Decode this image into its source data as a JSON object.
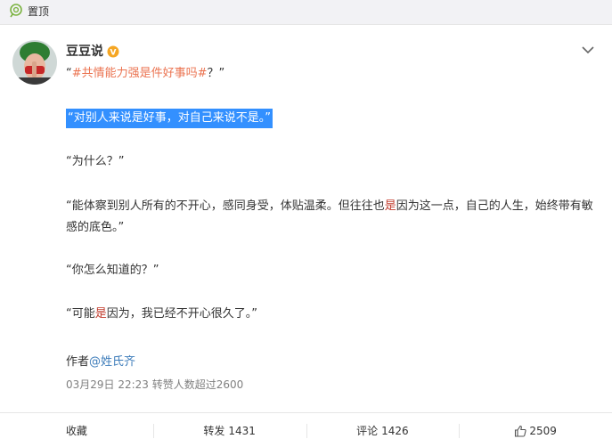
{
  "topbar": {
    "label": "置顶",
    "icon": "pin-icon"
  },
  "post": {
    "author": "豆豆说",
    "verified_badge": "V",
    "topic_open_quote": "“",
    "topic": "#共情能力强是件好事吗#",
    "topic_tail": "？”",
    "highlighted": "“对别人来说是好事，对自己来说不是。”",
    "p2": "“为什么？”",
    "p3_a": "“能体察到别人所有的不开心，感同身受，体贴温柔。但往往也",
    "p3_red": "是",
    "p3_b": "因为这一点，自己的人生，始终带有敏感的底色。”",
    "p4": "“你怎么知道的？”",
    "p5_a": "“可能",
    "p5_red": "是",
    "p5_b": "因为，我已经不开心很久了。”",
    "author_prefix": "作者",
    "mention": "@姓氏齐",
    "meta": "03月29日 22:23 转赞人数超过2600"
  },
  "actions": {
    "favorite": "收藏",
    "repost_label": "转发",
    "repost_count": "1431",
    "comment_label": "评论",
    "comment_count": "1426",
    "like_count": "2509"
  },
  "colors": {
    "topic": "#eb7350",
    "highlight_bg": "#3390ff",
    "mention": "#3d7cba",
    "meta": "#808080",
    "verified": "#f5a623"
  }
}
